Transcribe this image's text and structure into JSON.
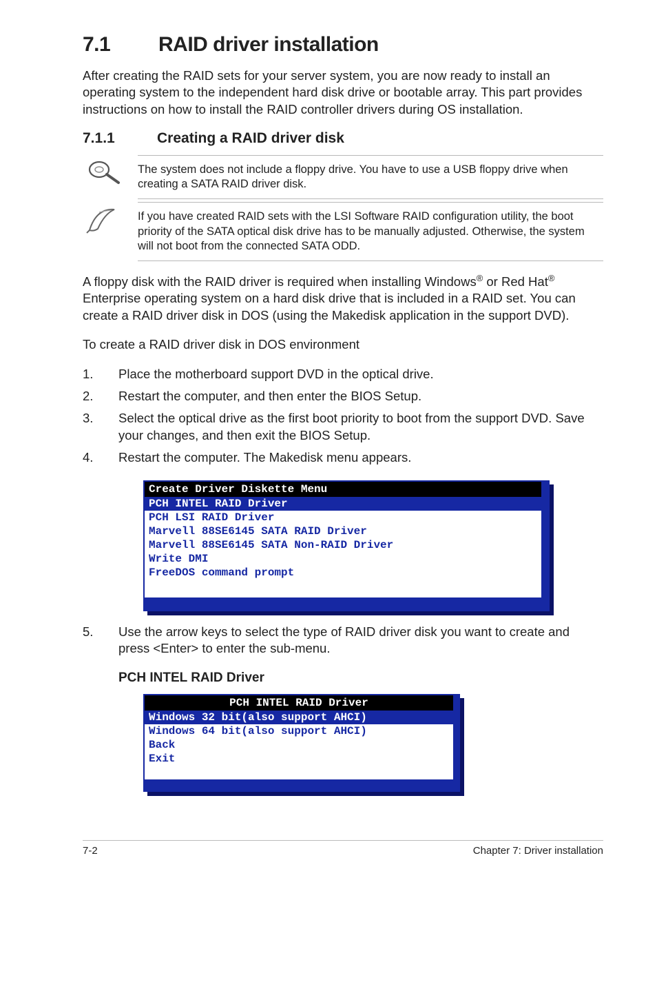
{
  "title": {
    "num": "7.1",
    "text": "RAID driver installation"
  },
  "intro": "After creating the RAID sets for your server system, you are now ready to install an operating system to the independent hard disk drive or bootable array. This part provides instructions on how to install the RAID controller drivers during OS installation.",
  "subsection": {
    "num": "7.1.1",
    "text": "Creating a RAID driver disk"
  },
  "note1": "The system does not include a floppy drive. You have to use a USB floppy drive when creating a SATA RAID driver disk.",
  "note2": "If you have created RAID sets with the LSI Software RAID configuration utility, the boot priority of the SATA optical disk drive has to be manually adjusted. Otherwise, the system will not boot from the connected SATA ODD.",
  "para_reg": {
    "p1a": "A floppy disk with the RAID driver is required when installing Windows",
    "p1b": " or Red Hat",
    "p1c": " Enterprise operating system on a hard disk drive that is included in a RAID set. You can create a RAID driver disk in DOS (using the Makedisk application in the support DVD).",
    "sup": "®"
  },
  "para_env": "To create a RAID driver disk in DOS environment",
  "steps": [
    {
      "n": "1.",
      "t": "Place the motherboard support DVD in the optical drive."
    },
    {
      "n": "2.",
      "t": "Restart the computer, and then enter the BIOS Setup."
    },
    {
      "n": "3.",
      "t": "Select the optical drive as the first boot priority to boot from the support DVD. Save your changes, and then exit the BIOS Setup."
    },
    {
      "n": "4.",
      "t": "Restart the computer. The Makedisk menu appears."
    }
  ],
  "console1": {
    "header": "Create Driver Diskette Menu",
    "selected": "PCH INTEL RAID Driver",
    "lines": [
      "PCH LSI RAID Driver",
      "Marvell 88SE6145 SATA RAID Driver",
      "Marvell 88SE6145 SATA Non-RAID Driver",
      "Write DMI",
      "FreeDOS command prompt"
    ]
  },
  "step5": {
    "n": "5.",
    "t": "Use the arrow keys to select the type of RAID driver disk you want to create and press <Enter> to enter the sub-menu."
  },
  "subhead2": "PCH INTEL RAID Driver",
  "console2": {
    "header": "PCH INTEL RAID Driver",
    "selected": "Windows 32 bit(also support AHCI)",
    "lines": [
      "Windows 64 bit(also support AHCI)",
      "Back",
      "Exit"
    ]
  },
  "footer": {
    "left": "7-2",
    "right": "Chapter 7: Driver installation"
  }
}
